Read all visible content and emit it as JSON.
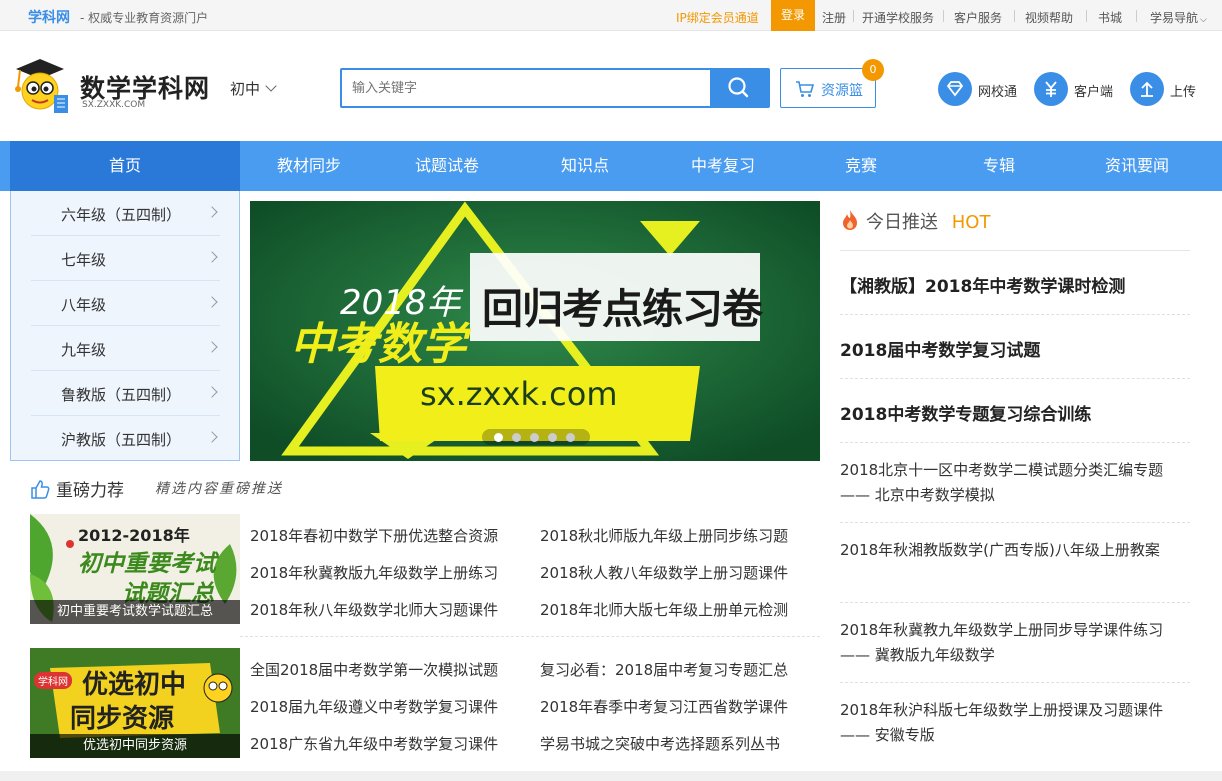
{
  "topbar": {
    "brand": "学科网",
    "slogan": "- 权威专业教育资源门户",
    "ip_link": "IP绑定会员通道",
    "login": "登录",
    "links": [
      "注册",
      "开通学校服务",
      "客户服务",
      "视频帮助",
      "书城",
      "学易导航"
    ]
  },
  "header": {
    "logo_text": "数学学科网",
    "logo_sub": "SX.ZXXK.COM",
    "grade": "初中",
    "search_placeholder": "输入关键字",
    "basket_label": "资源篮",
    "basket_count": "0",
    "icons": [
      {
        "label": "网校通",
        "icon": "diamond-icon"
      },
      {
        "label": "客户端",
        "icon": "yen-icon"
      },
      {
        "label": "上传",
        "icon": "upload-icon"
      }
    ]
  },
  "nav": [
    "首页",
    "教材同步",
    "试题试卷",
    "知识点",
    "中考复习",
    "竞赛",
    "专辑",
    "资讯要闻"
  ],
  "sidemenu": [
    "六年级（五四制）",
    "七年级",
    "八年级",
    "九年级",
    "鲁教版（五四制）",
    "沪教版（五四制）"
  ],
  "banner": {
    "year": "2018年",
    "title_left": "中考数学",
    "title_right": "回归考点练习卷",
    "url": "sx.zxxk.com",
    "slides": 5,
    "active_slide": 1
  },
  "hot": {
    "title": "今日推送",
    "tag": "HOT",
    "big": [
      "【湘教版】2018年中考数学课时检测",
      "2018届中考数学复习试题",
      "2018中考数学专题复习综合训练"
    ],
    "small": [
      {
        "line1": "2018北京十一区中考数学二模试题分类汇编专题",
        "line2": "—— 北京中考数学模拟"
      },
      {
        "line1": "2018年秋湘教版数学(广西专版)八年级上册教案",
        "line2": ""
      },
      {
        "line1": "2018年秋冀教九年级数学上册同步导学课件练习",
        "line2": "—— 冀教版九年级数学"
      },
      {
        "line1": "2018年秋沪科版七年级数学上册授课及习题课件",
        "line2": "—— 安徽专版"
      }
    ]
  },
  "recommend": {
    "title": "重磅力荐",
    "subtitle": "精选内容重磅推送",
    "blocks": [
      {
        "img_top": "2012-2018年",
        "img_mid": "初中重要考试",
        "img_bot": "试题汇总",
        "caption": "初中重要考试数学试题汇总",
        "links": [
          "2018年春初中数学下册优选整合资源",
          "2018秋北师版九年级上册同步练习题",
          "2018年秋冀教版九年级数学上册练习",
          "2018秋人教八年级数学上册习题课件",
          "2018年秋八年级数学北师大习题课件",
          "2018年北师大版七年级上册单元检测"
        ]
      },
      {
        "img_badge": "学科网",
        "img_mid": "优选初中",
        "img_bot": "同步资源",
        "caption": "优选初中同步资源",
        "links": [
          "全国2018届中考数学第一次模拟试题",
          "复习必看：2018届中考复习专题汇总",
          "2018届九年级遵义中考数学复习课件",
          "2018年春季中考复习江西省数学课件",
          "2018广东省九年级中考数学复习课件",
          "学易书城之突破中考选择题系列丛书"
        ]
      }
    ]
  }
}
